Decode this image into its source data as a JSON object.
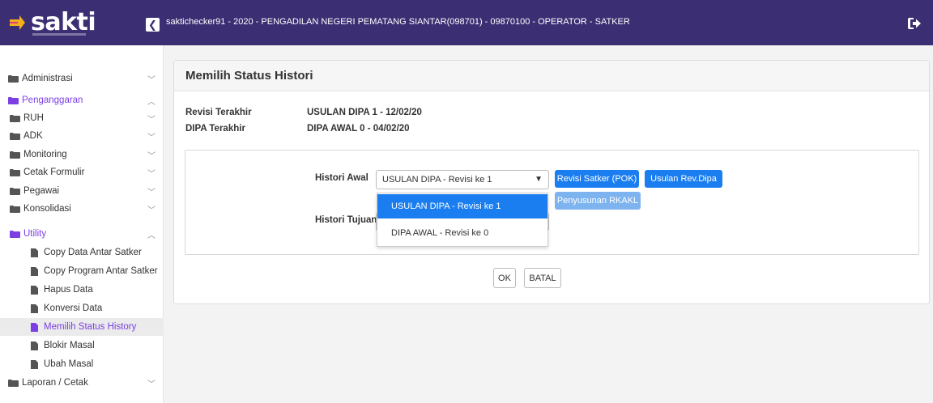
{
  "header": {
    "logo_text": "sakti",
    "title": "saktichecker91 - 2020 - PENGADILAN NEGERI PEMATANG SIANTAR(098701) - 09870100 - OPERATOR - SATKER",
    "collapse_glyph": "❮",
    "brand_color": "#3b2e72"
  },
  "sidebar": {
    "items": [
      {
        "label": "Administrasi",
        "icon": "folder-icon",
        "chevron": "﹀"
      },
      {
        "label": "Penganggaran",
        "icon": "folder-open-icon",
        "chevron": "︿"
      },
      {
        "label": "RUH",
        "icon": "folder-icon",
        "chevron": "﹀"
      },
      {
        "label": "ADK",
        "icon": "folder-icon",
        "chevron": "﹀"
      },
      {
        "label": "Monitoring",
        "icon": "folder-icon",
        "chevron": "﹀"
      },
      {
        "label": "Cetak Formulir",
        "icon": "folder-icon",
        "chevron": "﹀"
      },
      {
        "label": "Pegawai",
        "icon": "folder-icon",
        "chevron": "﹀"
      },
      {
        "label": "Konsolidasi",
        "icon": "folder-icon",
        "chevron": "﹀"
      },
      {
        "label": "Utility",
        "icon": "folder-open-icon",
        "chevron": "︿"
      },
      {
        "label": "Copy Data Antar Satker",
        "icon": "file-icon"
      },
      {
        "label": "Copy Program Antar Satker",
        "icon": "file-icon"
      },
      {
        "label": "Hapus Data",
        "icon": "file-icon"
      },
      {
        "label": "Konversi Data",
        "icon": "file-icon"
      },
      {
        "label": "Memilih Status History",
        "icon": "file-icon"
      },
      {
        "label": "Blokir Masal",
        "icon": "file-icon"
      },
      {
        "label": "Ubah Masal",
        "icon": "file-icon"
      },
      {
        "label": "Laporan / Cetak",
        "icon": "folder-icon",
        "chevron": "﹀"
      }
    ],
    "accent_color": "#7b3fe4"
  },
  "main": {
    "title": "Memilih Status Histori",
    "revisi_label": "Revisi Terakhir",
    "revisi_value": "USULAN DIPA 1 - 12/02/20",
    "dipa_label": "DIPA Terakhir",
    "dipa_value": "DIPA AWAL 0 - 04/02/20",
    "histori_awal_label": "Histori Awal",
    "histori_awal_value": "USULAN DIPA - Revisi ke 1",
    "histori_tujuan_label": "Histori Tujuan",
    "dropdown_options": [
      "USULAN DIPA - Revisi ke 1",
      "DIPA AWAL - Revisi ke 0"
    ],
    "btn_revisi_satker": "Revisi Satker (POK)",
    "btn_usulan_rev": "Usulan Rev.Dipa",
    "btn_penyusunan": "Penyusunan RKAKL",
    "btn_ok": "OK",
    "btn_batal": "BATAL"
  }
}
